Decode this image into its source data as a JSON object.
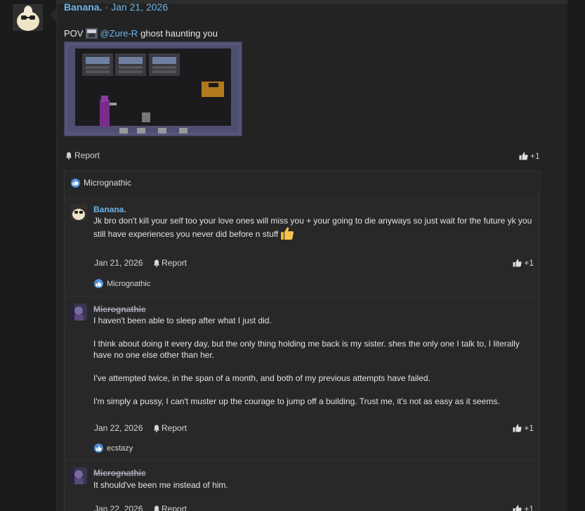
{
  "post": {
    "author": "Banana.",
    "separator": "·",
    "date": "Jan 21, 2026",
    "body_prefix": "POV",
    "mention": "@Zure-R",
    "body_suffix": "ghost haunting you",
    "report_label": "Report",
    "reaction_count": "+1",
    "reactions_by": "Micrognathic"
  },
  "replies": [
    {
      "author": "Banana.",
      "author_style": "normal",
      "paragraphs": [
        "Jk bro don't kill your self too your love ones will miss you + your going to die anyways so just wait for the future yk you still have experiences you never did before n stuff"
      ],
      "date": "Jan 21, 2026",
      "report_label": "Report",
      "reaction_count": "+1",
      "reactions_by": "Micrognathic"
    },
    {
      "author": "Micrognathic",
      "author_style": "banned",
      "paragraphs": [
        "I haven't been able to sleep after what I just did.",
        "I think about doing it every day, but the only thing holding me back is my sister. shes the only one I talk to, I literally have no one else other than her.",
        "I've attempted twice, in the span of a month, and both of my previous attempts have failed.",
        "I'm simply a pussy, I can't muster up the courage to jump off a building. Trust me, it's not as easy as it seems."
      ],
      "date": "Jan 22, 2026",
      "report_label": "Report",
      "reaction_count": "+1",
      "reactions_by": "ecstazy"
    },
    {
      "author": "Micrognathic",
      "author_style": "banned",
      "paragraphs": [
        "It should've been me instead of him."
      ],
      "date": "Jan 22, 2026",
      "report_label": "Report",
      "reaction_count": "+1"
    }
  ],
  "colors": {
    "link": "#6fb4e8",
    "like_badge": "#4d8fd6",
    "background": "#1c1c1c"
  },
  "icons": {
    "bell": "bell-icon",
    "thumbs_up": "thumbs-up-icon",
    "like_badge": "like-reaction-icon",
    "emoji": "thumbs-up-emoji"
  }
}
